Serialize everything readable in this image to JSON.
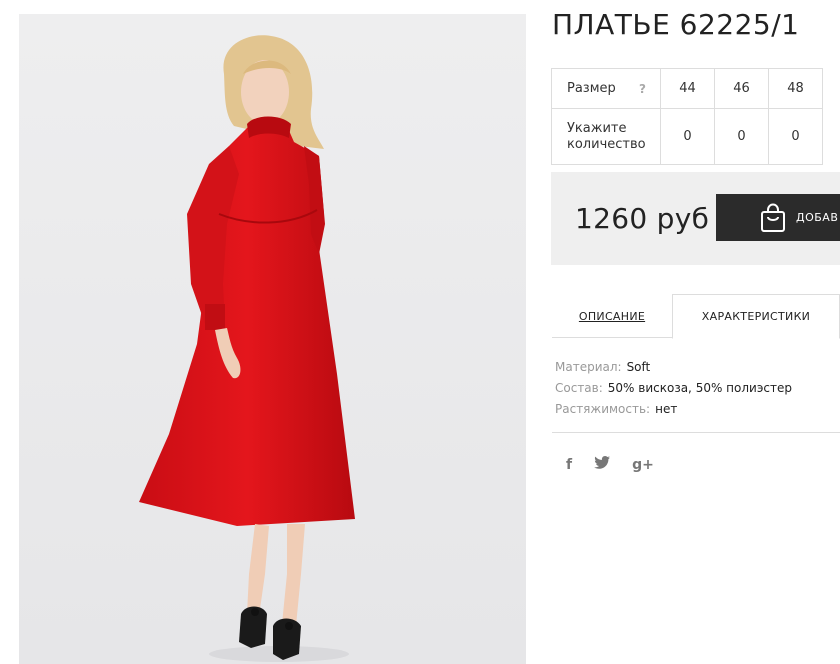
{
  "product": {
    "title": "ПЛАТЬЕ 62225/1",
    "image_alt": "red midi dress photo"
  },
  "size_table": {
    "size_label": "Размер",
    "help": "?",
    "sizes": [
      "44",
      "46",
      "48"
    ],
    "qty_label": "Укажите количество",
    "quantities": [
      "0",
      "0",
      "0"
    ]
  },
  "buy": {
    "price": "1260 руб",
    "add_label": "ДОБАВ"
  },
  "tabs": {
    "description": "ОПИСАНИЕ",
    "characteristics": "ХАРАКТЕРИСТИКИ"
  },
  "specs": [
    {
      "key": "Материал:",
      "value": "Soft"
    },
    {
      "key": "Состав:",
      "value": "50% вискоза, 50% полиэстер"
    },
    {
      "key": "Растяжимость:",
      "value": "нет"
    }
  ],
  "social": {
    "facebook": "f",
    "twitter": "t",
    "google_plus": "g+"
  },
  "colors": {
    "dress": "#e0141a",
    "button": "#2b2b2b",
    "buy_bg": "#efefef"
  }
}
